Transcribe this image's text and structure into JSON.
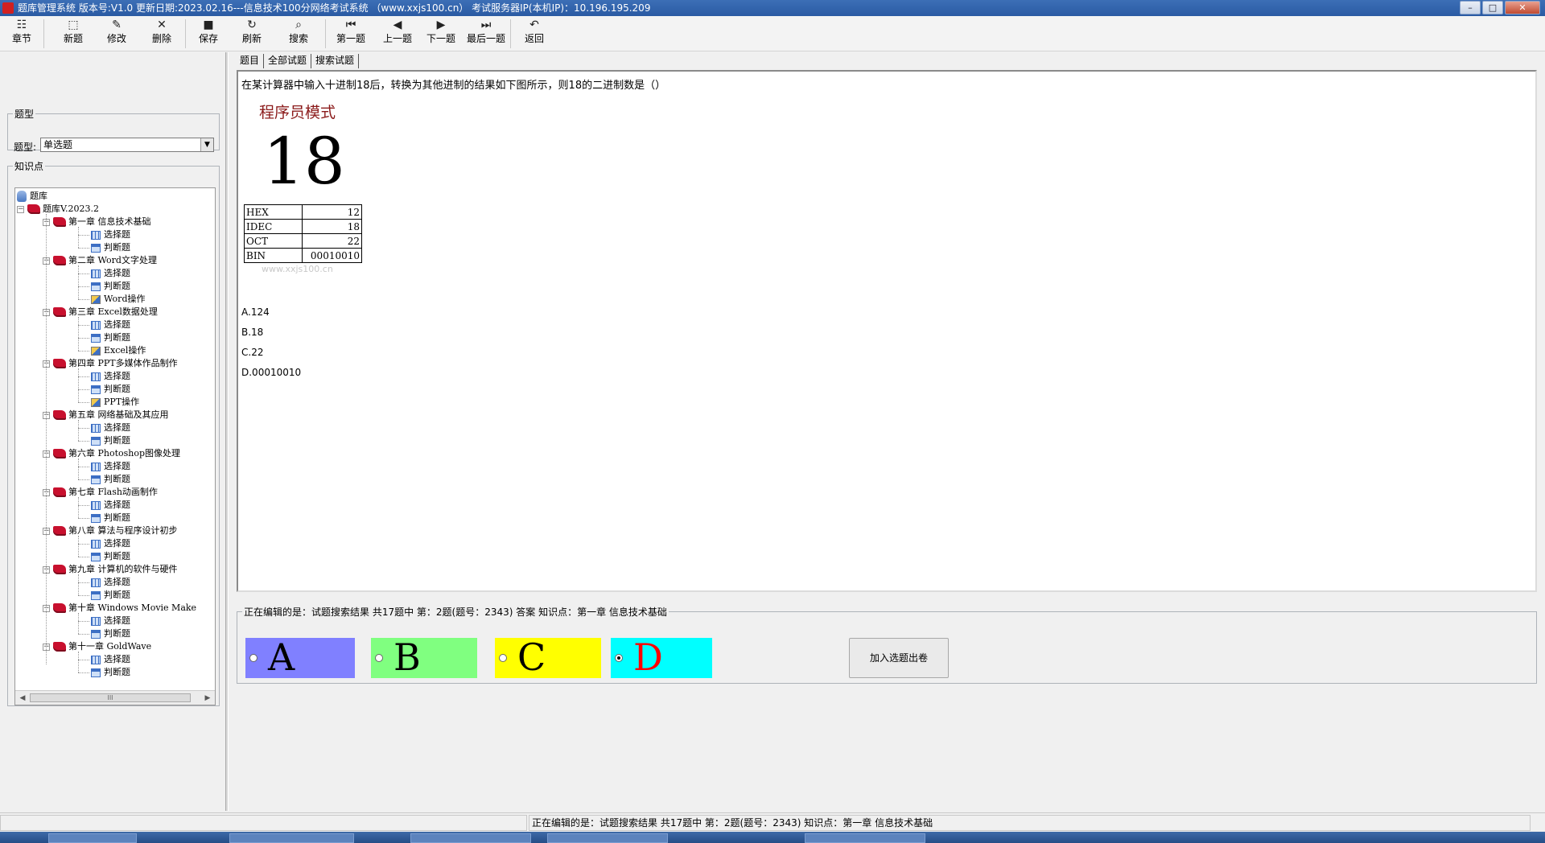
{
  "window": {
    "title": "题库管理系统 版本号:V1.0 更新日期:2023.02.16---信息技术100分网络考试系统 （www.xxjs100.cn） 考试服务器IP(本机IP)：10.196.195.209",
    "controls": [
      "–",
      "□",
      "✕"
    ]
  },
  "toolbar": {
    "buttons": [
      {
        "label": "章节",
        "icon": "chapter-icon",
        "glyph": "☷"
      },
      {
        "label": "新题",
        "icon": "new-question-icon",
        "glyph": "⬚"
      },
      {
        "label": "修改",
        "icon": "edit-icon",
        "glyph": "✎"
      },
      {
        "label": "删除",
        "icon": "delete-icon",
        "glyph": "✕"
      },
      {
        "label": "保存",
        "icon": "save-icon",
        "glyph": "■"
      },
      {
        "label": "刷新",
        "icon": "refresh-icon",
        "glyph": "↻"
      },
      {
        "label": "搜索",
        "icon": "search-icon",
        "glyph": "⌕"
      },
      {
        "label": "第一题",
        "icon": "first-icon",
        "glyph": "⏮"
      },
      {
        "label": "上一题",
        "icon": "prev-icon",
        "glyph": "◀"
      },
      {
        "label": "下一题",
        "icon": "next-icon",
        "glyph": "▶"
      },
      {
        "label": "最后一题",
        "icon": "last-icon",
        "glyph": "⏭"
      },
      {
        "label": "返回",
        "icon": "return-icon",
        "glyph": "↶"
      }
    ]
  },
  "left": {
    "type_group_label": "题型",
    "type_field_label": "题型:",
    "type_selected": "单选题",
    "knowledge_group_label": "知识点",
    "tree": {
      "root": "题库",
      "bank": "题库V.2023.2",
      "chapters": [
        {
          "name": "第一章 信息技术基础",
          "items": [
            "选择题",
            "判断题"
          ]
        },
        {
          "name": "第二章 Word文字处理",
          "items": [
            "选择题",
            "判断题",
            "Word操作"
          ]
        },
        {
          "name": "第三章 Excel数据处理",
          "items": [
            "选择题",
            "判断题",
            "Excel操作"
          ]
        },
        {
          "name": "第四章 PPT多媒体作品制作",
          "items": [
            "选择题",
            "判断题",
            "PPT操作"
          ]
        },
        {
          "name": "第五章 网络基础及其应用",
          "items": [
            "选择题",
            "判断题"
          ]
        },
        {
          "name": "第六章 Photoshop图像处理",
          "items": [
            "选择题",
            "判断题"
          ]
        },
        {
          "name": "第七章 Flash动画制作",
          "items": [
            "选择题",
            "判断题"
          ]
        },
        {
          "name": "第八章 算法与程序设计初步",
          "items": [
            "选择题",
            "判断题"
          ]
        },
        {
          "name": "第九章 计算机的软件与硬件",
          "items": [
            "选择题",
            "判断题"
          ]
        },
        {
          "name": "第十章 Windows Movie Make",
          "items": [
            "选择题",
            "判断题"
          ]
        },
        {
          "name": "第十一章 GoldWave",
          "items": [
            "选择题",
            "判断题"
          ]
        }
      ]
    }
  },
  "tabs": [
    "题目",
    "全部试题",
    "搜索试题"
  ],
  "question": {
    "text": "在某计算器中输入十进制18后，转换为其他进制的结果如下图所示，则18的二进制数是（）",
    "calc_mode": "程序员模式",
    "calc_value": "18",
    "calc_rows": [
      {
        "k": "HEX",
        "v": "12"
      },
      {
        "k": "IDEC",
        "v": "18"
      },
      {
        "k": "OCT",
        "v": "22"
      },
      {
        "k": "BIN",
        "v": "00010010"
      }
    ],
    "watermark": "www.xxjs100.cn",
    "options": [
      "A.124",
      "B.18",
      "C.22",
      "D.00010010"
    ]
  },
  "answer": {
    "legend": "正在编辑的是：试题搜索结果 共17题中  第：2题(题号：2343) 答案 知识点：第一章 信息技术基础",
    "choices": [
      {
        "letter": "A",
        "bg": "#8080ff",
        "color": "#000000",
        "selected": false
      },
      {
        "letter": "B",
        "bg": "#80ff80",
        "color": "#000000",
        "selected": false
      },
      {
        "letter": "C",
        "bg": "#ffff00",
        "color": "#000000",
        "selected": false
      },
      {
        "letter": "D",
        "bg": "#00ffff",
        "color": "#ff0000",
        "selected": true
      }
    ],
    "add_button": "加入选题出卷"
  },
  "status": {
    "text": "正在编辑的是：试题搜索结果 共17题中  第：2题(题号：2343)  知识点：第一章 信息技术基础"
  }
}
